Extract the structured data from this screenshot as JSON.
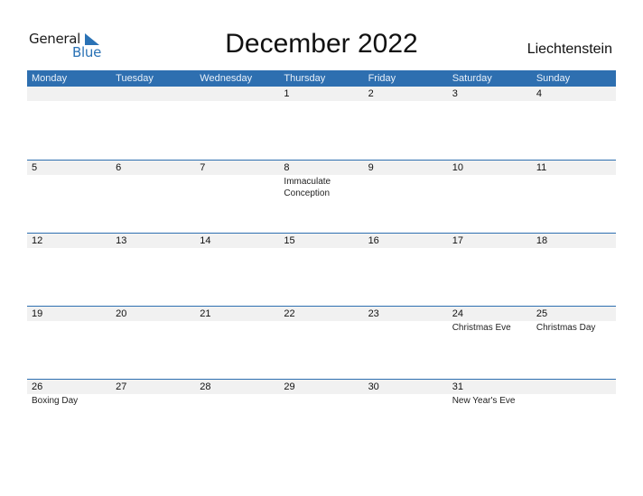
{
  "logo": {
    "text_top": "General",
    "text_bottom": "Blue"
  },
  "title": "December 2022",
  "country": "Liechtenstein",
  "colors": {
    "accent": "#2e6fb0",
    "date_strip": "#f1f1f1"
  },
  "weekdays": [
    "Monday",
    "Tuesday",
    "Wednesday",
    "Thursday",
    "Friday",
    "Saturday",
    "Sunday"
  ],
  "weeks": [
    {
      "days": [
        {
          "num": "",
          "event": ""
        },
        {
          "num": "",
          "event": ""
        },
        {
          "num": "",
          "event": ""
        },
        {
          "num": "1",
          "event": ""
        },
        {
          "num": "2",
          "event": ""
        },
        {
          "num": "3",
          "event": ""
        },
        {
          "num": "4",
          "event": ""
        }
      ]
    },
    {
      "days": [
        {
          "num": "5",
          "event": ""
        },
        {
          "num": "6",
          "event": ""
        },
        {
          "num": "7",
          "event": ""
        },
        {
          "num": "8",
          "event": "Immaculate Conception"
        },
        {
          "num": "9",
          "event": ""
        },
        {
          "num": "10",
          "event": ""
        },
        {
          "num": "11",
          "event": ""
        }
      ]
    },
    {
      "days": [
        {
          "num": "12",
          "event": ""
        },
        {
          "num": "13",
          "event": ""
        },
        {
          "num": "14",
          "event": ""
        },
        {
          "num": "15",
          "event": ""
        },
        {
          "num": "16",
          "event": ""
        },
        {
          "num": "17",
          "event": ""
        },
        {
          "num": "18",
          "event": ""
        }
      ]
    },
    {
      "days": [
        {
          "num": "19",
          "event": ""
        },
        {
          "num": "20",
          "event": ""
        },
        {
          "num": "21",
          "event": ""
        },
        {
          "num": "22",
          "event": ""
        },
        {
          "num": "23",
          "event": ""
        },
        {
          "num": "24",
          "event": "Christmas Eve"
        },
        {
          "num": "25",
          "event": "Christmas Day"
        }
      ]
    },
    {
      "days": [
        {
          "num": "26",
          "event": "Boxing Day"
        },
        {
          "num": "27",
          "event": ""
        },
        {
          "num": "28",
          "event": ""
        },
        {
          "num": "29",
          "event": ""
        },
        {
          "num": "30",
          "event": ""
        },
        {
          "num": "31",
          "event": "New Year's Eve"
        },
        {
          "num": "",
          "event": ""
        }
      ]
    }
  ]
}
